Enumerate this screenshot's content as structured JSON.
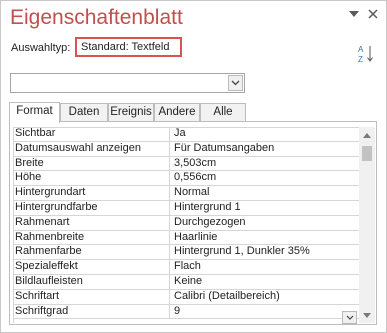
{
  "pane": {
    "title": "Eigenschaftenblatt",
    "selection_type_label": "Auswahltyp:",
    "selection_type_value": "Standard: Textfeld",
    "sort_icon": "sort-az-icon",
    "pin_icon": "dropdown-arrow-icon",
    "close_icon": "close-icon"
  },
  "object_selector": {
    "value": ""
  },
  "tabs": [
    {
      "label": "Format",
      "active": true
    },
    {
      "label": "Daten",
      "active": false
    },
    {
      "label": "Ereignis",
      "active": false
    },
    {
      "label": "Andere",
      "active": false
    },
    {
      "label": "Alle",
      "active": false
    }
  ],
  "properties": [
    {
      "name": "Sichtbar",
      "value": "Ja"
    },
    {
      "name": "Datumsauswahl anzeigen",
      "value": "Für Datumsangaben"
    },
    {
      "name": "Breite",
      "value": "3,503cm"
    },
    {
      "name": "Höhe",
      "value": "0,556cm"
    },
    {
      "name": "Hintergrundart",
      "value": "Normal"
    },
    {
      "name": "Hintergrundfarbe",
      "value": "Hintergrund 1"
    },
    {
      "name": "Rahmenart",
      "value": "Durchgezogen"
    },
    {
      "name": "Rahmenbreite",
      "value": "Haarlinie"
    },
    {
      "name": "Rahmenfarbe",
      "value": "Hintergrund 1, Dunkler 35%"
    },
    {
      "name": "Spezialeffekt",
      "value": "Flach"
    },
    {
      "name": "Bildlaufleisten",
      "value": "Keine"
    },
    {
      "name": "Schriftart",
      "value": "Calibri (Detailbereich)"
    },
    {
      "name": "Schriftgrad",
      "value": "9"
    }
  ],
  "colors": {
    "title": "#c0504d",
    "highlight_border": "#d9534f"
  }
}
